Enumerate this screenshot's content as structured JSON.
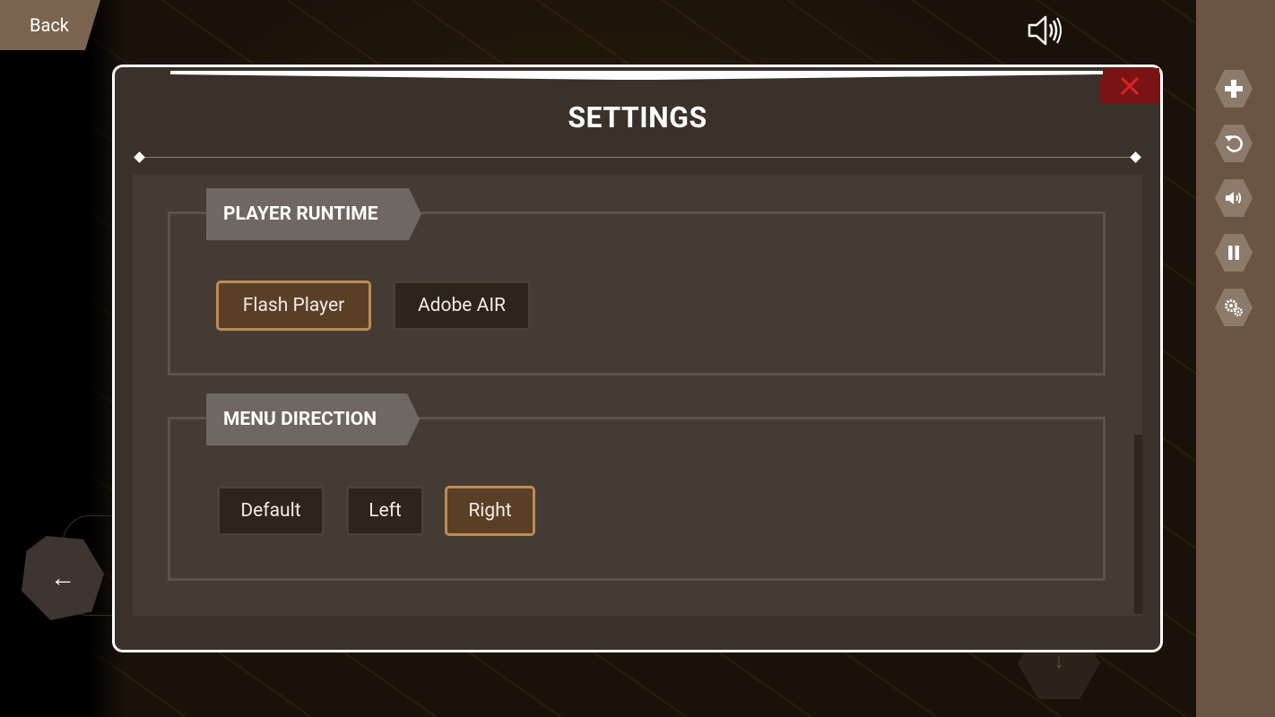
{
  "top_bar": {
    "back_label": "Back"
  },
  "panel": {
    "title": "SETTINGS",
    "close_icon": "close-icon",
    "sections": [
      {
        "label": "PLAYER RUNTIME",
        "options": [
          {
            "label": "Flash Player",
            "selected": true
          },
          {
            "label": "Adobe AIR",
            "selected": false
          }
        ]
      },
      {
        "label": "MENU DIRECTION",
        "options": [
          {
            "label": "Default",
            "selected": false
          },
          {
            "label": "Left",
            "selected": false
          },
          {
            "label": "Right",
            "selected": true
          }
        ]
      }
    ]
  },
  "sidebar": {
    "items": [
      {
        "icon": "gamepad-icon"
      },
      {
        "icon": "restart-icon"
      },
      {
        "icon": "volume-icon"
      },
      {
        "icon": "pause-icon"
      },
      {
        "icon": "gears-icon"
      }
    ]
  },
  "colors": {
    "panel_bg": "#3a312b",
    "selected_border": "#c08a52",
    "close_bg": "#7a1414",
    "close_x": "#e02020",
    "sidebar_bg": "#6b5441"
  }
}
